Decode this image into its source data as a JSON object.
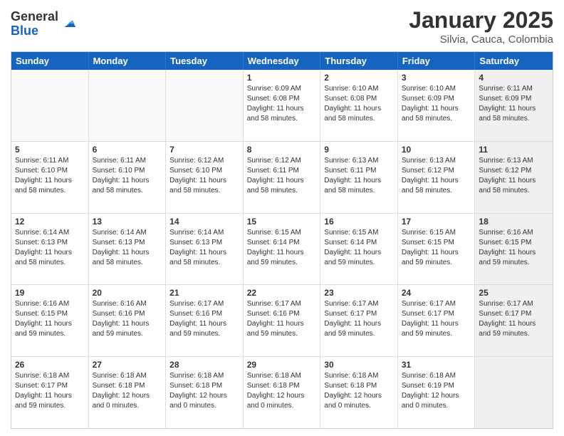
{
  "logo": {
    "general": "General",
    "blue": "Blue"
  },
  "title": "January 2025",
  "subtitle": "Silvia, Cauca, Colombia",
  "days": [
    "Sunday",
    "Monday",
    "Tuesday",
    "Wednesday",
    "Thursday",
    "Friday",
    "Saturday"
  ],
  "weeks": [
    [
      {
        "day": "",
        "info": "",
        "empty": true
      },
      {
        "day": "",
        "info": "",
        "empty": true
      },
      {
        "day": "",
        "info": "",
        "empty": true
      },
      {
        "day": "1",
        "info": "Sunrise: 6:09 AM\nSunset: 6:08 PM\nDaylight: 11 hours and 58 minutes."
      },
      {
        "day": "2",
        "info": "Sunrise: 6:10 AM\nSunset: 6:08 PM\nDaylight: 11 hours and 58 minutes."
      },
      {
        "day": "3",
        "info": "Sunrise: 6:10 AM\nSunset: 6:09 PM\nDaylight: 11 hours and 58 minutes."
      },
      {
        "day": "4",
        "info": "Sunrise: 6:11 AM\nSunset: 6:09 PM\nDaylight: 11 hours and 58 minutes.",
        "shaded": true
      }
    ],
    [
      {
        "day": "5",
        "info": "Sunrise: 6:11 AM\nSunset: 6:10 PM\nDaylight: 11 hours and 58 minutes."
      },
      {
        "day": "6",
        "info": "Sunrise: 6:11 AM\nSunset: 6:10 PM\nDaylight: 11 hours and 58 minutes."
      },
      {
        "day": "7",
        "info": "Sunrise: 6:12 AM\nSunset: 6:10 PM\nDaylight: 11 hours and 58 minutes."
      },
      {
        "day": "8",
        "info": "Sunrise: 6:12 AM\nSunset: 6:11 PM\nDaylight: 11 hours and 58 minutes."
      },
      {
        "day": "9",
        "info": "Sunrise: 6:13 AM\nSunset: 6:11 PM\nDaylight: 11 hours and 58 minutes."
      },
      {
        "day": "10",
        "info": "Sunrise: 6:13 AM\nSunset: 6:12 PM\nDaylight: 11 hours and 58 minutes."
      },
      {
        "day": "11",
        "info": "Sunrise: 6:13 AM\nSunset: 6:12 PM\nDaylight: 11 hours and 58 minutes.",
        "shaded": true
      }
    ],
    [
      {
        "day": "12",
        "info": "Sunrise: 6:14 AM\nSunset: 6:13 PM\nDaylight: 11 hours and 58 minutes."
      },
      {
        "day": "13",
        "info": "Sunrise: 6:14 AM\nSunset: 6:13 PM\nDaylight: 11 hours and 58 minutes."
      },
      {
        "day": "14",
        "info": "Sunrise: 6:14 AM\nSunset: 6:13 PM\nDaylight: 11 hours and 58 minutes."
      },
      {
        "day": "15",
        "info": "Sunrise: 6:15 AM\nSunset: 6:14 PM\nDaylight: 11 hours and 59 minutes."
      },
      {
        "day": "16",
        "info": "Sunrise: 6:15 AM\nSunset: 6:14 PM\nDaylight: 11 hours and 59 minutes."
      },
      {
        "day": "17",
        "info": "Sunrise: 6:15 AM\nSunset: 6:15 PM\nDaylight: 11 hours and 59 minutes."
      },
      {
        "day": "18",
        "info": "Sunrise: 6:16 AM\nSunset: 6:15 PM\nDaylight: 11 hours and 59 minutes.",
        "shaded": true
      }
    ],
    [
      {
        "day": "19",
        "info": "Sunrise: 6:16 AM\nSunset: 6:15 PM\nDaylight: 11 hours and 59 minutes."
      },
      {
        "day": "20",
        "info": "Sunrise: 6:16 AM\nSunset: 6:16 PM\nDaylight: 11 hours and 59 minutes."
      },
      {
        "day": "21",
        "info": "Sunrise: 6:17 AM\nSunset: 6:16 PM\nDaylight: 11 hours and 59 minutes."
      },
      {
        "day": "22",
        "info": "Sunrise: 6:17 AM\nSunset: 6:16 PM\nDaylight: 11 hours and 59 minutes."
      },
      {
        "day": "23",
        "info": "Sunrise: 6:17 AM\nSunset: 6:17 PM\nDaylight: 11 hours and 59 minutes."
      },
      {
        "day": "24",
        "info": "Sunrise: 6:17 AM\nSunset: 6:17 PM\nDaylight: 11 hours and 59 minutes."
      },
      {
        "day": "25",
        "info": "Sunrise: 6:17 AM\nSunset: 6:17 PM\nDaylight: 11 hours and 59 minutes.",
        "shaded": true
      }
    ],
    [
      {
        "day": "26",
        "info": "Sunrise: 6:18 AM\nSunset: 6:17 PM\nDaylight: 11 hours and 59 minutes."
      },
      {
        "day": "27",
        "info": "Sunrise: 6:18 AM\nSunset: 6:18 PM\nDaylight: 12 hours and 0 minutes."
      },
      {
        "day": "28",
        "info": "Sunrise: 6:18 AM\nSunset: 6:18 PM\nDaylight: 12 hours and 0 minutes."
      },
      {
        "day": "29",
        "info": "Sunrise: 6:18 AM\nSunset: 6:18 PM\nDaylight: 12 hours and 0 minutes."
      },
      {
        "day": "30",
        "info": "Sunrise: 6:18 AM\nSunset: 6:18 PM\nDaylight: 12 hours and 0 minutes."
      },
      {
        "day": "31",
        "info": "Sunrise: 6:18 AM\nSunset: 6:19 PM\nDaylight: 12 hours and 0 minutes."
      },
      {
        "day": "",
        "info": "",
        "empty": true,
        "shaded": true
      }
    ]
  ]
}
